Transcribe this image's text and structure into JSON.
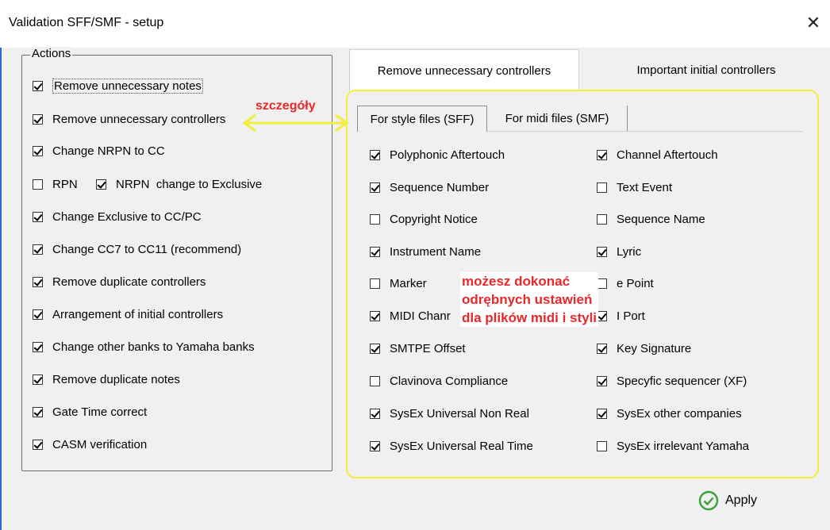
{
  "window": {
    "title": "Validation SFF/SMF - setup",
    "close_glyph": "✕"
  },
  "actions": {
    "group_title": "Actions",
    "items": [
      {
        "label": "Remove unnecessary notes",
        "checked": true
      },
      {
        "label": "Remove unnecessary controllers",
        "checked": true
      },
      {
        "label": "Change NRPN to CC",
        "checked": true
      },
      {
        "label": "RPN",
        "checked": false
      },
      {
        "label": "NRPN  change to Exclusive",
        "checked": true
      },
      {
        "label": "Change Exclusive to CC/PC",
        "checked": true
      },
      {
        "label": "Change CC7 to CC11 (recommend)",
        "checked": true
      },
      {
        "label": "Remove duplicate controllers",
        "checked": true
      },
      {
        "label": "Arrangement of initial controllers",
        "checked": true
      },
      {
        "label": "Change other banks to Yamaha banks",
        "checked": true
      },
      {
        "label": "Remove duplicate notes",
        "checked": true
      },
      {
        "label": "Gate Time correct",
        "checked": true
      },
      {
        "label": "CASM verification",
        "checked": true
      }
    ]
  },
  "tabs": {
    "outer": [
      {
        "label": "Remove unnecessary controllers",
        "active": true
      },
      {
        "label": "Important initial controllers",
        "active": false
      }
    ],
    "inner": [
      {
        "label": "For style files (SFF)",
        "active": true
      },
      {
        "label": "For midi files (SMF)",
        "active": false
      }
    ]
  },
  "events": {
    "left": [
      {
        "label": "Polyphonic Aftertouch",
        "checked": true
      },
      {
        "label": "Sequence Number",
        "checked": true
      },
      {
        "label": "Copyright Notice",
        "checked": false
      },
      {
        "label": "Instrument Name",
        "checked": true
      },
      {
        "label": "Marker",
        "checked": false
      },
      {
        "label": "MIDI Chanr",
        "checked": true
      },
      {
        "label": "SMTPE Offset",
        "checked": true
      },
      {
        "label": "Clavinova Compliance",
        "checked": false
      },
      {
        "label": "SysEx Universal Non Real",
        "checked": true
      },
      {
        "label": "SysEx Universal Real Time",
        "checked": true
      }
    ],
    "right": [
      {
        "label": "Channel Aftertouch",
        "checked": true
      },
      {
        "label": "Text Event",
        "checked": false
      },
      {
        "label": "Sequence Name",
        "checked": false
      },
      {
        "label": "Lyric",
        "checked": true
      },
      {
        "label": "e Point",
        "checked": false
      },
      {
        "label": "I Port",
        "checked": true
      },
      {
        "label": "Key Signature",
        "checked": true
      },
      {
        "label": "Specyfic sequencer (XF)",
        "checked": true
      },
      {
        "label": "SysEx other companies",
        "checked": true
      },
      {
        "label": "SysEx irrelevant Yamaha",
        "checked": false
      }
    ]
  },
  "annotations": {
    "small": "szczegóły",
    "big": [
      "możesz dokonać",
      "odrębnych ustawień",
      "dla plików midi i styli"
    ],
    "color": "#e8282a",
    "highlight_color": "#f2ee3a"
  },
  "apply": {
    "label": "Apply",
    "icon": "check-circle-icon",
    "icon_color": "#3aa23a"
  }
}
